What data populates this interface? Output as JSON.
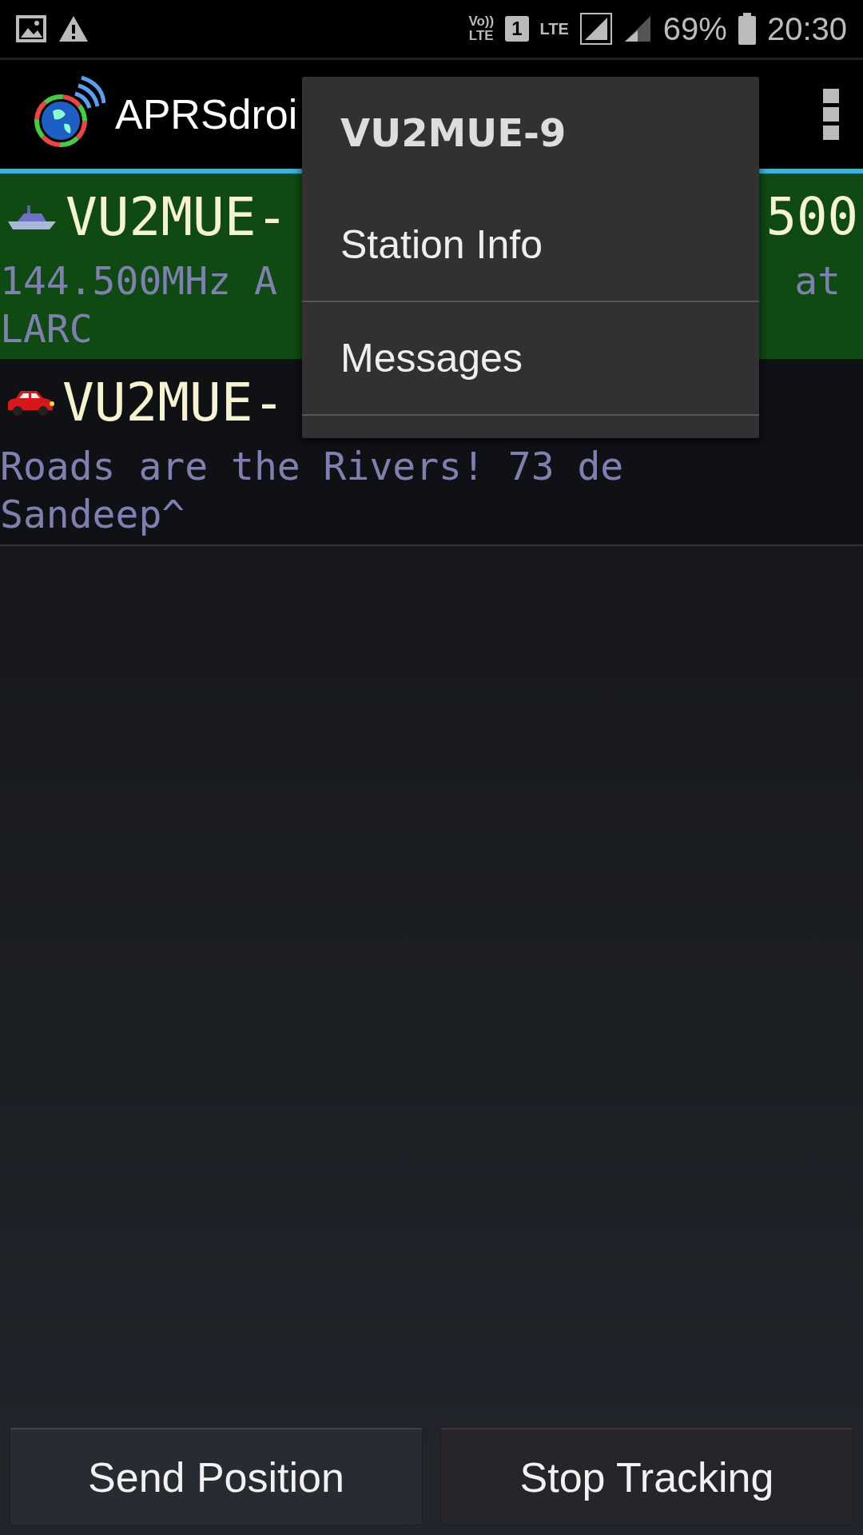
{
  "status_bar": {
    "volte": [
      "Vo))",
      "LTE"
    ],
    "sim": "1",
    "network": "LTE",
    "battery": "69%",
    "time": "20:30"
  },
  "action_bar": {
    "title": "APRSdroi"
  },
  "stations": [
    {
      "kind": "boat",
      "selected": true,
      "callsign": "VU2MUE-",
      "callsign_end": "500",
      "lines": [
        {
          "left": "144.500MHz A",
          "right": "at"
        },
        {
          "left": "LARC"
        }
      ]
    },
    {
      "kind": "car",
      "selected": false,
      "callsign": "VU2MUE-",
      "lines": [
        {
          "left": "Roads are the Rivers! 73 de"
        },
        {
          "left": "Sandeep^"
        }
      ]
    }
  ],
  "menu": {
    "title": "VU2MUE-9",
    "items": [
      "Station Info",
      "Messages"
    ]
  },
  "buttons": [
    "Send Position",
    "Stop Tracking"
  ]
}
